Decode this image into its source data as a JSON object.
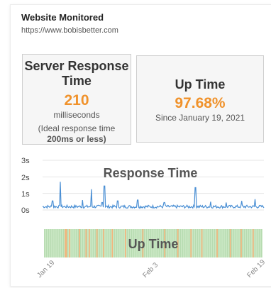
{
  "website": {
    "heading": "Website Monitored",
    "url": "https://www.bobisbetter.com"
  },
  "server_response": {
    "title_line1": "Server Response",
    "title_line2": "Time",
    "value": "210",
    "unit": "milliseconds",
    "ideal_line1": "(Ideal response time",
    "ideal_line2": "200ms or less)"
  },
  "uptime": {
    "title": "Up Time",
    "value": "97.68%",
    "since": "Since January 19, 2021"
  },
  "colors": {
    "accent_orange": "#f0922b",
    "line_blue": "#4a8fd4",
    "uptime_green": "#c8e6c2",
    "outage_orange": "#f3b37a"
  },
  "chart_data": [
    {
      "type": "line",
      "title": "Response Time",
      "ylim": [
        0,
        3
      ],
      "y_ticks": [
        "3s",
        "2s",
        "1s",
        "0s"
      ],
      "grid": true,
      "baseline_seconds": 0.2,
      "spikes": [
        {
          "t": 0.08,
          "v": 1.7
        },
        {
          "t": 0.045,
          "v": 0.55
        },
        {
          "t": 0.18,
          "v": 0.6
        },
        {
          "t": 0.22,
          "v": 1.25
        },
        {
          "t": 0.27,
          "v": 0.45
        },
        {
          "t": 0.28,
          "v": 1.45
        },
        {
          "t": 0.34,
          "v": 0.55
        },
        {
          "t": 0.43,
          "v": 0.6
        },
        {
          "t": 0.55,
          "v": 0.45
        },
        {
          "t": 0.69,
          "v": 1.35
        },
        {
          "t": 0.76,
          "v": 0.5
        },
        {
          "t": 0.83,
          "v": 0.45
        },
        {
          "t": 0.9,
          "v": 0.55
        },
        {
          "t": 0.96,
          "v": 0.65
        }
      ]
    },
    {
      "type": "heatmap",
      "title": "Up Time",
      "x_tick_labels": [
        "Jan 19",
        "Feb 3",
        "Feb 19"
      ],
      "outages": [
        0.095,
        0.1,
        0.115,
        0.16,
        0.19,
        0.205,
        0.24,
        0.27,
        0.31,
        0.37,
        0.45,
        0.55,
        0.61,
        0.67,
        0.72,
        0.79,
        0.85,
        0.9,
        0.955
      ]
    }
  ]
}
